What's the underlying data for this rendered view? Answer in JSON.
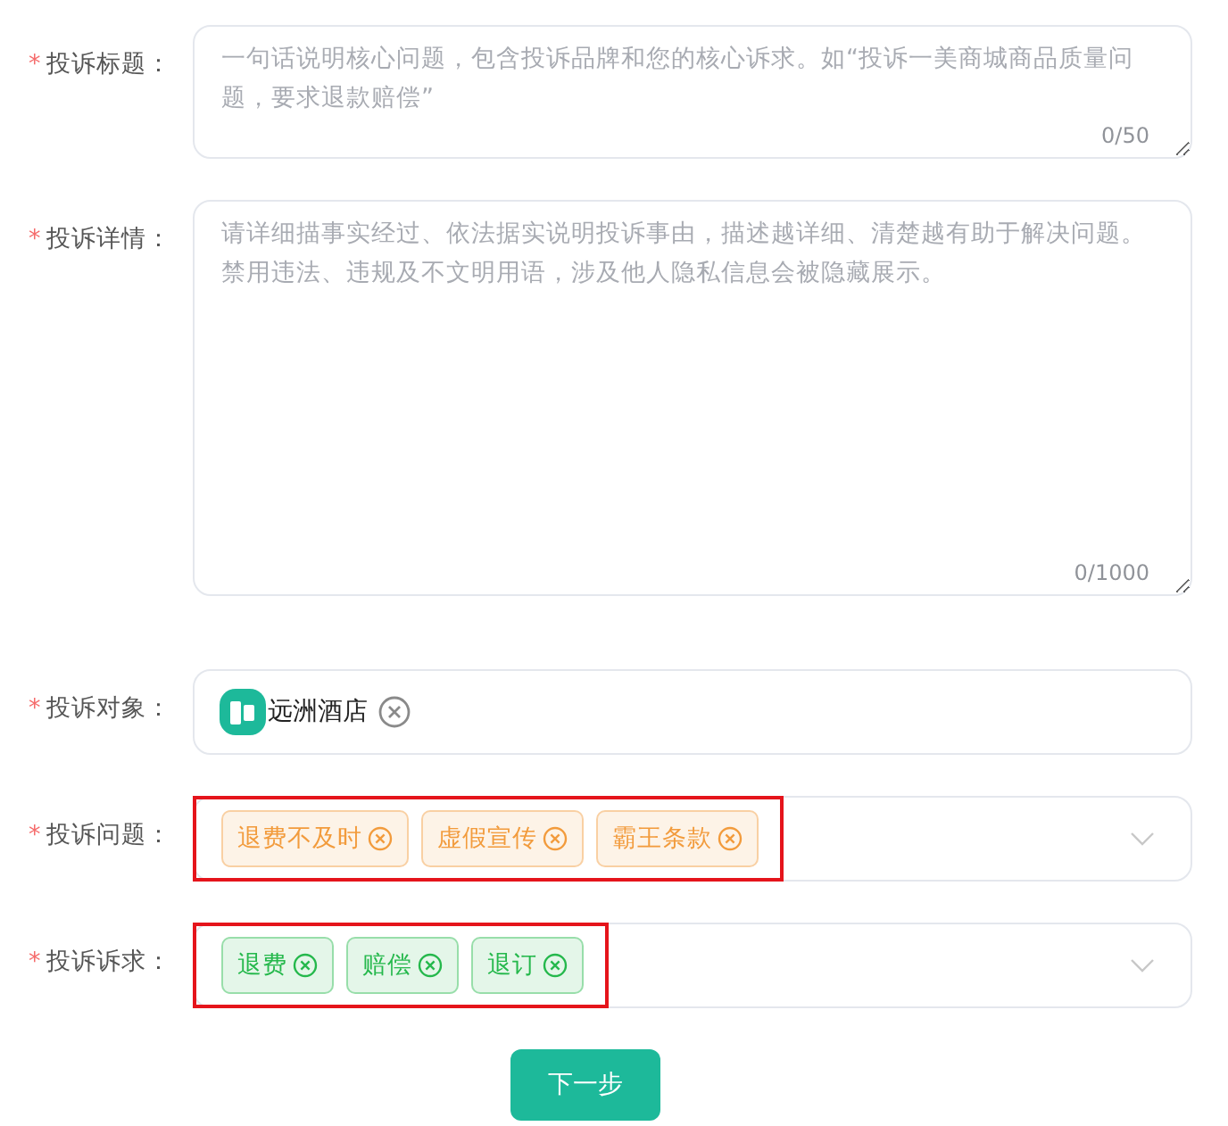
{
  "fields": [
    {
      "kind": "textarea",
      "mark": "*",
      "label": "投诉标题：",
      "placeholder": "一句话说明核心问题，包含投诉品牌和您的核心诉求。如“投诉一美商城商品质量问题，要求退款赔偿”",
      "counter": "0/50"
    },
    {
      "kind": "textarea",
      "mark": "*",
      "label": "投诉详情：",
      "placeholder": "请详细描事实经过、依法据实说明投诉事由，描述越详细、清楚越有助于解决问题。禁用违法、违规及不文明用语，涉及他人隐私信息会被隐藏展示。",
      "counter": "0/1000"
    },
    {
      "kind": "object",
      "mark": "*",
      "label": "投诉对象：",
      "value": "远洲酒店"
    },
    {
      "kind": "tags",
      "mark": "*",
      "label": "投诉问题：",
      "color": "#f29b3c",
      "highlighted": true,
      "tags": [
        "退费不及时",
        "虚假宣传",
        "霸王条款"
      ]
    },
    {
      "kind": "tags",
      "mark": "*",
      "label": "投诉诉求：",
      "color": "#25b84c",
      "highlighted": true,
      "tags": [
        "退费",
        "赔偿",
        "退订"
      ]
    }
  ],
  "submit": "下一步"
}
